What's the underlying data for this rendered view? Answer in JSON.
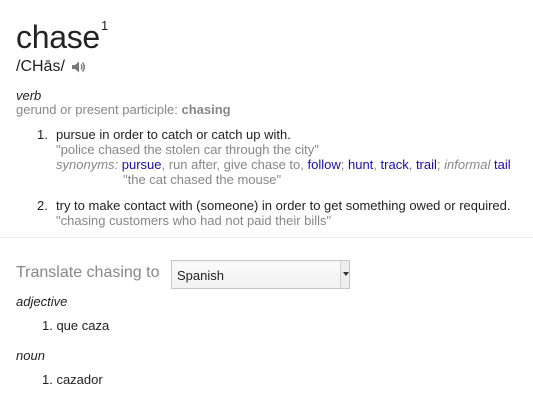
{
  "entry": {
    "word": "chase",
    "superscript": "1",
    "phonetic": "/CHās/",
    "speaker_icon": "speaker-icon"
  },
  "verb": {
    "pos": "verb",
    "gerund_label": "gerund or present participle: ",
    "gerund_value": "chasing",
    "definitions": [
      {
        "num": "1.",
        "meaning": "pursue in order to catch or catch up with.",
        "example": "\"police chased the stolen car through the city\"",
        "synonyms_label": "synonyms:",
        "synonyms": [
          {
            "text": "pursue",
            "link": true
          },
          {
            "text": ", run after, give chase to, ",
            "link": false
          },
          {
            "text": "follow",
            "link": true
          },
          {
            "text": "; ",
            "link": false
          },
          {
            "text": "hunt",
            "link": true
          },
          {
            "text": ", ",
            "link": false
          },
          {
            "text": "track",
            "link": true
          },
          {
            "text": ", ",
            "link": false
          },
          {
            "text": "trail",
            "link": true
          },
          {
            "text": "; ",
            "link": false
          }
        ],
        "informal_label": "informal",
        "informal_link": "tail",
        "syn_example": "\"the cat chased the mouse\""
      },
      {
        "num": "2.",
        "meaning": "try to make contact with (someone) in order to get something owed or required.",
        "example": "\"chasing customers who had not paid their bills\""
      }
    ]
  },
  "translate": {
    "label": "Translate chasing to",
    "selected_language": "Spanish",
    "adjective_label": "adjective",
    "adjective_items": [
      "1. que caza"
    ],
    "noun_label": "noun",
    "noun_items": [
      "1. cazador"
    ]
  }
}
